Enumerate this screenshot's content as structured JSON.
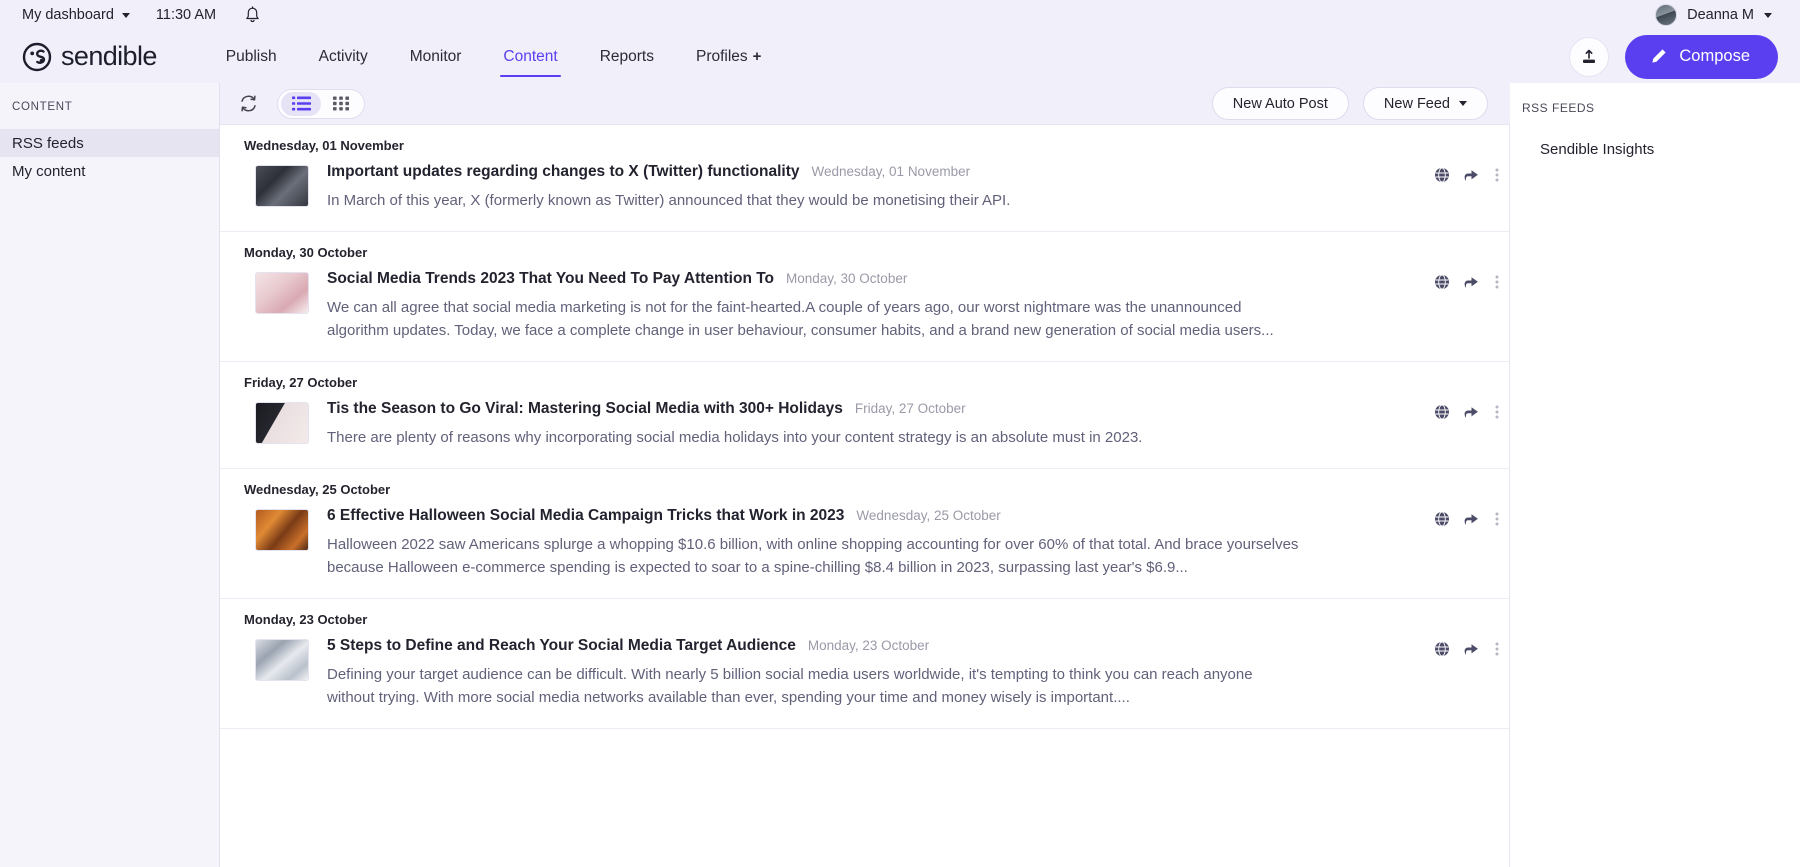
{
  "utility_bar": {
    "dashboard_label": "My dashboard",
    "time": "11:30 AM",
    "bell_icon": "bell-icon",
    "user_name": "Deanna M",
    "user_caret_icon": "chevron-down-icon"
  },
  "nav": {
    "brand": "sendible",
    "items": [
      {
        "label": "Publish",
        "active": false
      },
      {
        "label": "Activity",
        "active": false
      },
      {
        "label": "Monitor",
        "active": false
      },
      {
        "label": "Content",
        "active": true
      },
      {
        "label": "Reports",
        "active": false
      },
      {
        "label": "Profiles",
        "active": false,
        "suffix": "+"
      }
    ],
    "upload_icon": "upload-icon",
    "compose_label": "Compose",
    "compose_icon": "pencil-icon",
    "accent_color": "#5a3ff0"
  },
  "sidebar": {
    "heading": "CONTENT",
    "items": [
      {
        "label": "RSS feeds",
        "selected": true
      },
      {
        "label": "My content",
        "selected": false
      }
    ]
  },
  "toolbar": {
    "refresh_icon": "refresh-icon",
    "views": [
      {
        "name": "list-view",
        "icon": "list-icon",
        "active": true
      },
      {
        "name": "grid-view",
        "icon": "grid-icon",
        "active": false
      }
    ],
    "new_auto_post_label": "New Auto Post",
    "new_feed_label": "New Feed",
    "new_feed_caret_icon": "chevron-down-icon"
  },
  "right_panel": {
    "heading": "RSS FEEDS",
    "feeds": [
      {
        "label": "Sendible Insights"
      }
    ]
  },
  "feed": {
    "row_actions": [
      {
        "name": "globe-icon"
      },
      {
        "name": "share-icon"
      },
      {
        "name": "more-vertical-icon"
      }
    ],
    "groups": [
      {
        "date": "Wednesday, 01 November",
        "articles": [
          {
            "title": "Important updates regarding changes to X (Twitter) functionality",
            "date": "Wednesday, 01 November",
            "description": "In March of this year, X (formerly known as Twitter) announced that they would be monetising their API.",
            "thumb_class": "th-1"
          }
        ]
      },
      {
        "date": "Monday, 30 October",
        "articles": [
          {
            "title": "Social Media Trends 2023 That You Need To Pay Attention To",
            "date": "Monday, 30 October",
            "description": "We can all agree that social media marketing is not for the faint-hearted.A couple of years ago, our worst nightmare was the unannounced algorithm updates. Today, we face a complete change in user behaviour, consumer habits, and a brand new generation of social media users...",
            "thumb_class": "th-2"
          }
        ]
      },
      {
        "date": "Friday, 27 October",
        "articles": [
          {
            "title": "Tis the Season to Go Viral: Mastering Social Media with 300+ Holidays",
            "date": "Friday, 27 October",
            "description": "There are plenty of reasons why incorporating social media holidays into your content strategy is an absolute must in 2023.",
            "thumb_class": "th-3"
          }
        ]
      },
      {
        "date": "Wednesday, 25 October",
        "articles": [
          {
            "title": "6 Effective Halloween Social Media Campaign Tricks that Work in 2023",
            "date": "Wednesday, 25 October",
            "description": "Halloween 2022 saw Americans splurge a whopping $10.6 billion, with online shopping accounting for over 60% of that total. And brace yourselves because Halloween e-commerce spending is expected to soar to a spine-chilling $8.4 billion in 2023, surpassing last year's $6.9...",
            "thumb_class": "th-4"
          }
        ]
      },
      {
        "date": "Monday, 23 October",
        "articles": [
          {
            "title": "5 Steps to Define and Reach Your Social Media Target Audience",
            "date": "Monday, 23 October",
            "description": "Defining your target audience can be difficult. With nearly 5 billion social media users worldwide, it's tempting to think you can reach anyone without trying.  With more social media networks available than ever, spending your time and money wisely is important....",
            "thumb_class": "th-5"
          }
        ]
      }
    ]
  }
}
